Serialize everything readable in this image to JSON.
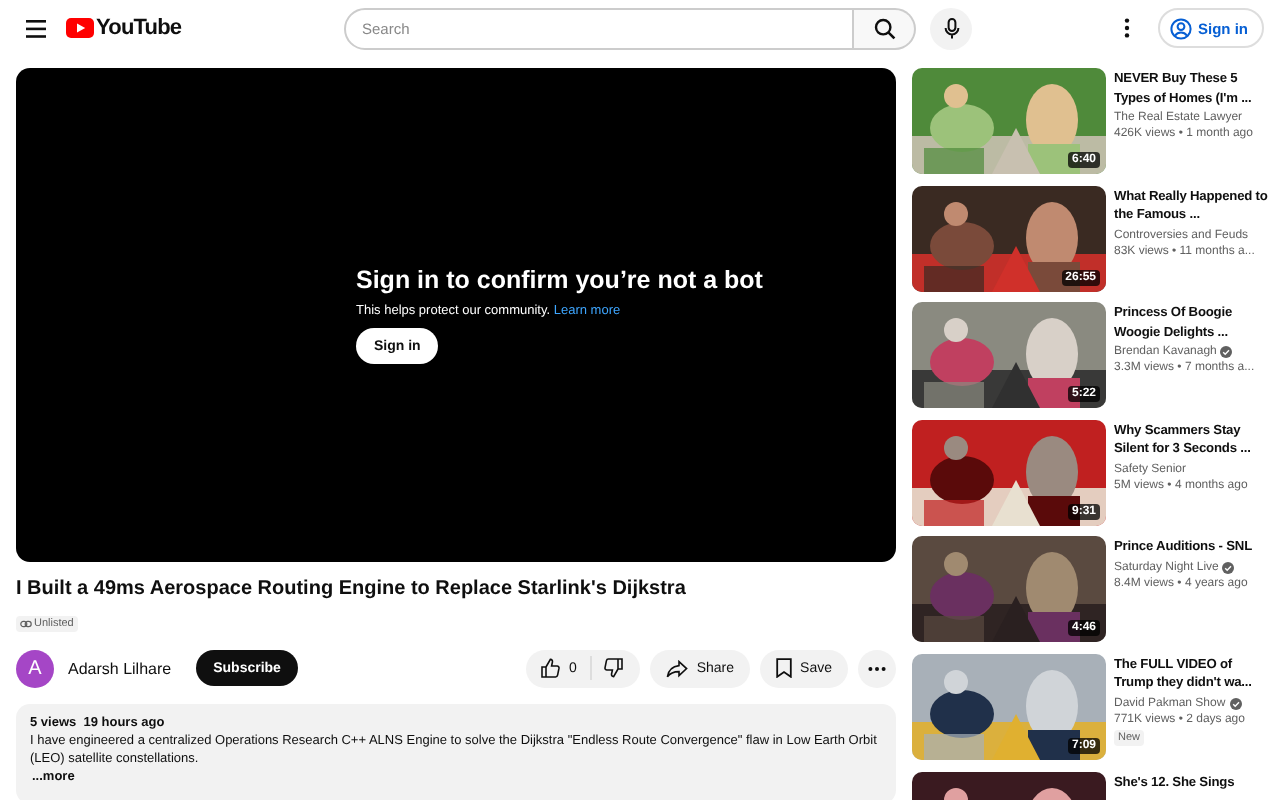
{
  "header": {
    "logo": "YouTube",
    "search": {
      "placeholder": "Search"
    },
    "sign_in": "Sign in"
  },
  "player": {
    "heading": "Sign in to confirm you’re not a bot",
    "message": "This helps protect our community.",
    "link": "Learn more",
    "button": "Sign in"
  },
  "video": {
    "title": "I Built a 49ms Aerospace Routing Engine to Replace Starlink's Dijkstra",
    "visibility": "Unlisted",
    "channel": {
      "avatar": "A",
      "name": "Adarsh Lilhare"
    },
    "subscribe": "Subscribe",
    "likes": "0",
    "share": "Share",
    "save": "Save",
    "description": {
      "stats": "5 views  19 hours ago",
      "text": "I have engineered a centralized Operations Research C++ ALNS Engine to solve the Dijkstra \"Endless Route Convergence\" flaw in Low Earth Orbit (LEO) satellite constellations.",
      "more": "...more"
    }
  },
  "related": [
    {
      "title": "NEVER Buy These 5 Types of Homes (I'm ...",
      "channel": "The Real Estate Lawyer",
      "verified": false,
      "stats": "426K views • 1 month ago",
      "duration": "6:40"
    },
    {
      "title": "What Really Happened to the Famous ...",
      "channel": "Controversies and Feuds",
      "verified": false,
      "stats": "83K views • 11 months a...",
      "duration": "26:55"
    },
    {
      "title": "Princess Of Boogie Woogie Delights ...",
      "channel": "Brendan Kavanagh",
      "verified": true,
      "stats": "3.3M views • 7 months a...",
      "duration": "5:22"
    },
    {
      "title": "Why Scammers Stay Silent for 3 Seconds ...",
      "channel": "Safety Senior",
      "verified": false,
      "stats": "5M views • 4 months ago",
      "duration": "9:31"
    },
    {
      "title": "Prince Auditions - SNL",
      "channel": "Saturday Night Live",
      "verified": true,
      "stats": "8.4M views • 4 years ago",
      "duration": "4:46"
    },
    {
      "title": "The FULL VIDEO of Trump they didn't wa...",
      "channel": "David Pakman Show",
      "verified": true,
      "stats": "771K views • 2 days ago",
      "duration": "7:09",
      "badge": "New"
    },
    {
      "title": "She's 12. She Sings"
    }
  ]
}
